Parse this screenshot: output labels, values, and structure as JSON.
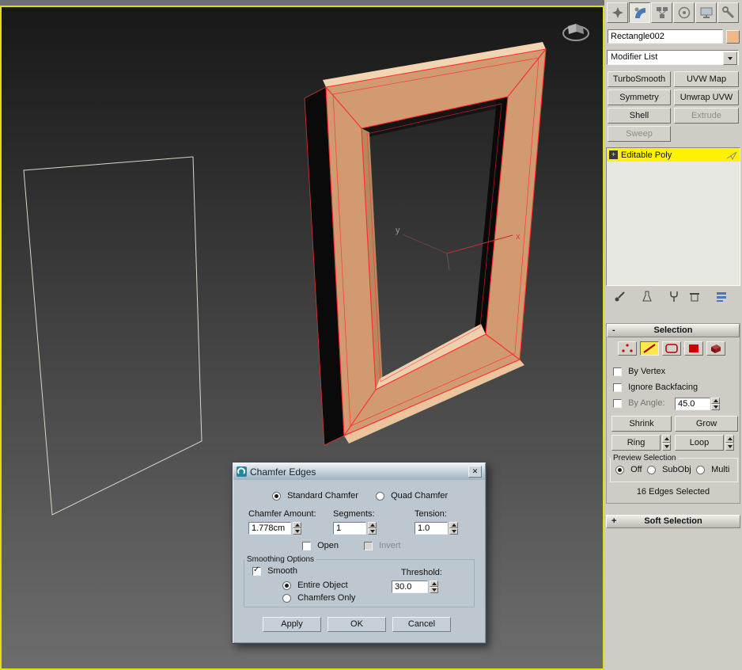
{
  "colors": {
    "viewport_border": "#dede12",
    "stack_highlight": "#fff200",
    "selected_edge_red": "#ff2a2a",
    "frame_tan": "#d29a70",
    "object_swatch": "#edb98a"
  },
  "glyphs": {
    "close": "✕"
  },
  "viewport": {
    "axis_x": "x",
    "axis_y": "y"
  },
  "command_panel": {
    "tab_icons": [
      "create-icon",
      "modify-icon",
      "hierarchy-icon",
      "motion-icon",
      "display-icon",
      "utilities-icon"
    ],
    "object_name": "Rectangle002",
    "modifier_list": "Modifier List",
    "buttons": {
      "turbosmooth": "TurboSmooth",
      "uvw_map": "UVW Map",
      "symmetry": "Symmetry",
      "unwrap_uvw": "Unwrap UVW",
      "shell": "Shell",
      "extrude": "Extrude",
      "sweep": "Sweep"
    },
    "stack_expand": "+",
    "stack_item": "Editable Poly",
    "rollout_minus": "-",
    "rollout_plus": "+",
    "selection": {
      "header": "Selection",
      "subobject_icons": [
        "vertex-icon",
        "edge-icon",
        "border-icon",
        "polygon-icon",
        "element-icon"
      ],
      "by_vertex": "By Vertex",
      "ignore_backfacing": "Ignore Backfacing",
      "by_angle": "By Angle:",
      "by_angle_value": "45.0",
      "shrink": "Shrink",
      "grow": "Grow",
      "ring": "Ring",
      "loop": "Loop",
      "preview_legend": "Preview Selection",
      "preview_off": "Off",
      "preview_subobj": "SubObj",
      "preview_multi": "Multi",
      "status": "16 Edges Selected"
    },
    "soft_selection": "Soft Selection"
  },
  "dialog": {
    "title": "Chamfer Edges",
    "standard_chamfer": "Standard Chamfer",
    "quad_chamfer": "Quad Chamfer",
    "chamfer_amount_label": "Chamfer Amount:",
    "chamfer_amount_value": "1.778cm",
    "segments_label": "Segments:",
    "segments_value": "1",
    "tension_label": "Tension:",
    "tension_value": "1.0",
    "open_label": "Open",
    "invert_label": "Invert",
    "smoothing_legend": "Smoothing Options",
    "smooth_label": "Smooth",
    "entire_object": "Entire Object",
    "chamfers_only": "Chamfers Only",
    "threshold_label": "Threshold:",
    "threshold_value": "30.0",
    "apply": "Apply",
    "ok": "OK",
    "cancel": "Cancel"
  }
}
